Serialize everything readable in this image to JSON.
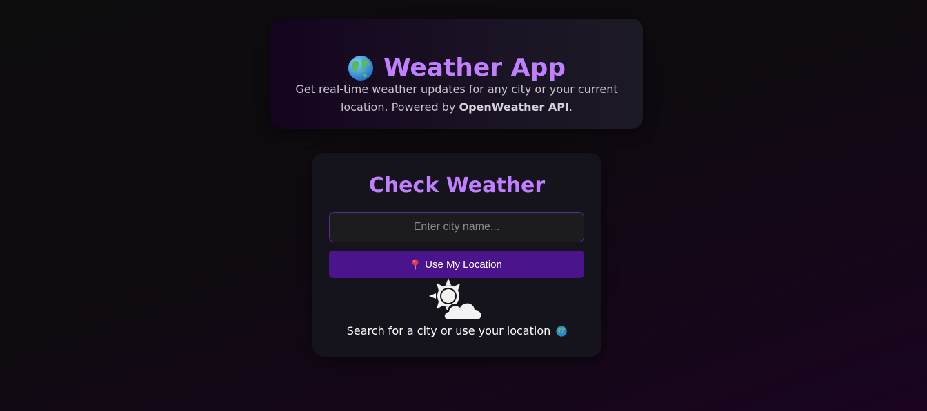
{
  "header": {
    "globe_icon": "globe-icon",
    "title": "Weather App",
    "subtitle_before": "Get real-time weather updates for any city or your current location. Powered by ",
    "subtitle_strong": "OpenWeather API",
    "subtitle_after": "."
  },
  "weather_card": {
    "title": "Check Weather",
    "search": {
      "placeholder": "Enter city name...",
      "value": ""
    },
    "location_button": {
      "icon": "pin-icon",
      "label": "Use My Location"
    },
    "status_icon": "sun-behind-cloud-icon",
    "hint": "Search for a city or use your location",
    "hint_icon": "globe-icon"
  },
  "colors": {
    "accent": "#bf7fff",
    "button": "#4a148c",
    "card": "#15141c",
    "input_border": "#5a2a9a"
  }
}
